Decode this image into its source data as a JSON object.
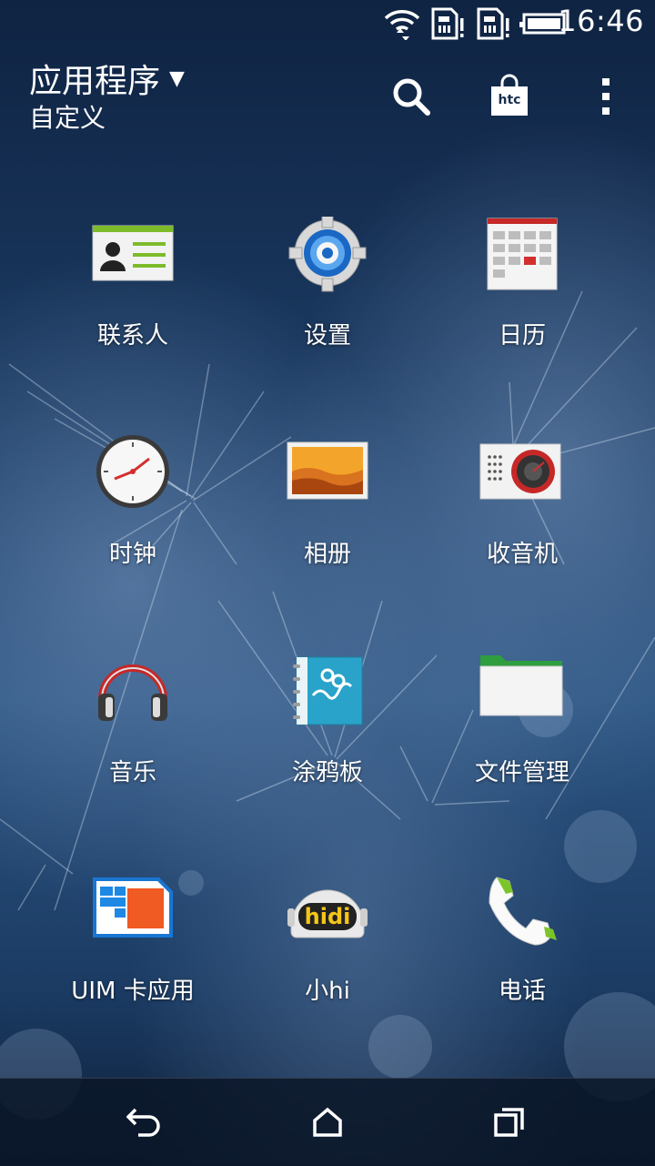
{
  "status_bar": {
    "time": "16:46",
    "icons": [
      "wifi-icon",
      "sim1-no-signal-icon",
      "sim2-no-signal-icon",
      "battery-icon"
    ]
  },
  "header": {
    "title": "应用程序",
    "subtitle": "自定义",
    "actions": [
      "search-icon",
      "htc-store-icon",
      "more-vertical-icon"
    ]
  },
  "apps": [
    {
      "label": "联系人",
      "icon": "contacts-icon"
    },
    {
      "label": "设置",
      "icon": "settings-gear-icon"
    },
    {
      "label": "日历",
      "icon": "calendar-icon"
    },
    {
      "label": "时钟",
      "icon": "clock-icon"
    },
    {
      "label": "相册",
      "icon": "gallery-icon"
    },
    {
      "label": "收音机",
      "icon": "radio-icon"
    },
    {
      "label": "音乐",
      "icon": "headphones-icon"
    },
    {
      "label": "涂鸦板",
      "icon": "scribble-notebook-icon"
    },
    {
      "label": "文件管理",
      "icon": "folder-icon"
    },
    {
      "label": "UIM 卡应用",
      "icon": "sim-card-icon"
    },
    {
      "label": "小hi",
      "icon": "hidi-robot-icon"
    },
    {
      "label": "电话",
      "icon": "phone-handset-icon"
    }
  ],
  "hidi_text": "hidi",
  "htc_text": "htc",
  "nav_bar": [
    "back-icon",
    "home-icon",
    "recent-apps-icon"
  ]
}
